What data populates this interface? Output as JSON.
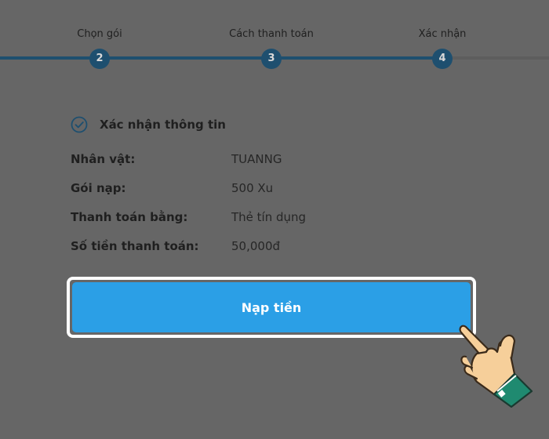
{
  "stepper": {
    "steps": [
      {
        "label": "Chọn gói",
        "number": "2"
      },
      {
        "label": "Cách thanh toán",
        "number": "3"
      },
      {
        "label": "Xác nhận",
        "number": "4"
      }
    ],
    "active_step": "4"
  },
  "confirm": {
    "title": "Xác nhận thông tin",
    "icon": "check-circle-icon",
    "rows": [
      {
        "label": "Nhân vật:",
        "value": "TUANNG"
      },
      {
        "label": "Gói nạp:",
        "value": "500 Xu"
      },
      {
        "label": "Thanh toán bằng:",
        "value": "Thẻ tín dụng"
      },
      {
        "label": "Số tiền thanh toán:",
        "value": "50,000đ"
      }
    ]
  },
  "cta": {
    "label": "Nạp tiền"
  },
  "colors": {
    "page_overlay": "#666666",
    "step_accent": "#1e4f6f",
    "button": "#2b9fe6",
    "button_text": "#ffffff"
  },
  "annotation": {
    "icon": "pointing-hand-icon"
  }
}
